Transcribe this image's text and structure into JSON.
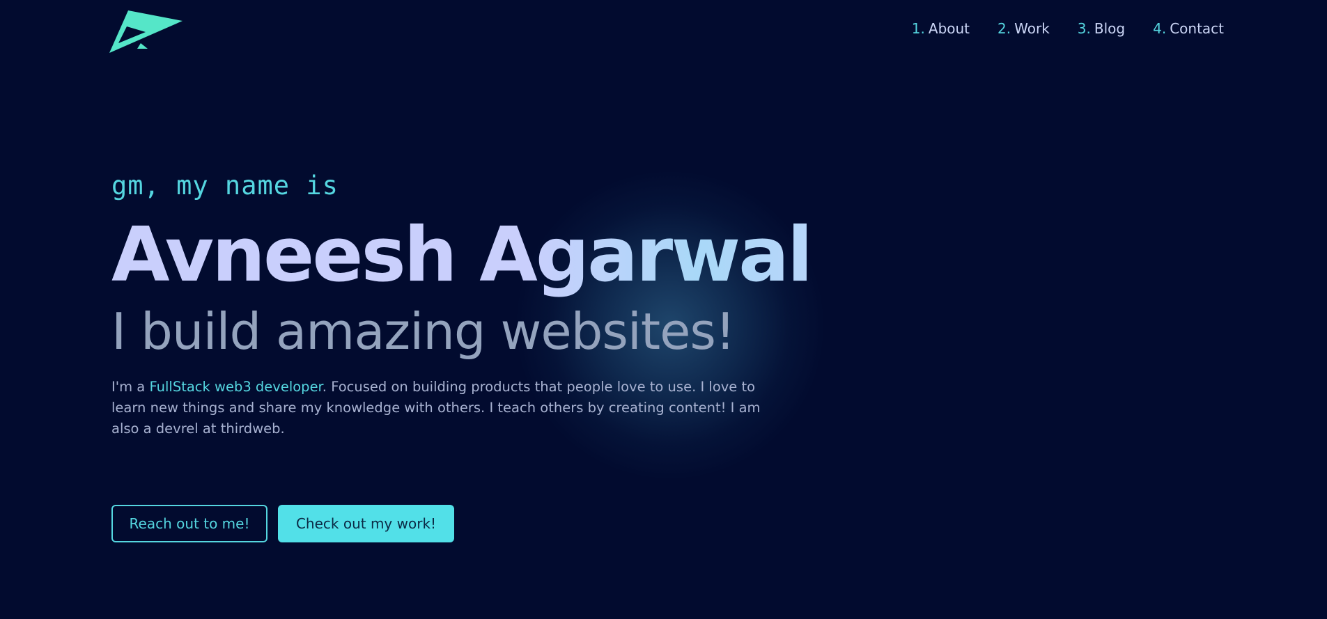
{
  "colors": {
    "background": "#020b2f",
    "accent": "#55d6e0",
    "heading": "#c9cffc",
    "tagline": "#94a3bd",
    "body_text": "#a8b2d1"
  },
  "header": {
    "logo_icon": "stylized-a-logo-icon",
    "nav": [
      {
        "num": "1.",
        "label": "About"
      },
      {
        "num": "2.",
        "label": "Work"
      },
      {
        "num": "3.",
        "label": "Blog"
      },
      {
        "num": "4.",
        "label": "Contact"
      }
    ]
  },
  "hero": {
    "greeting": "gm, my name is",
    "name": "Avneesh Agarwal",
    "tagline": "I build amazing websites!",
    "bio": {
      "prefix": "I'm a ",
      "highlight": "FullStack web3 developer",
      "suffix": ". Focused on building products that people love to use. I love to learn new things and share my knowledge with others. I teach others by creating content! I am also a devrel at thirdweb."
    },
    "buttons": {
      "reach_out": "Reach out to me!",
      "check_work": "Check out my work!"
    }
  }
}
